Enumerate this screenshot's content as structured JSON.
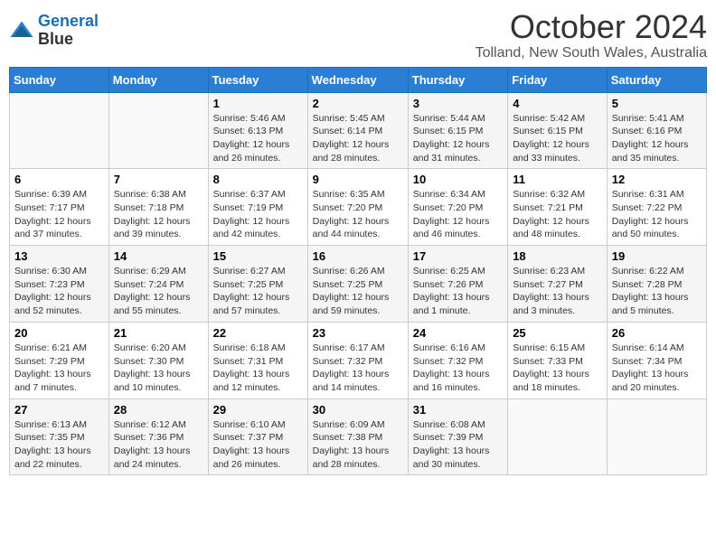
{
  "header": {
    "logo_line1": "General",
    "logo_line2": "Blue",
    "title": "October 2024",
    "subtitle": "Tolland, New South Wales, Australia"
  },
  "days_of_week": [
    "Sunday",
    "Monday",
    "Tuesday",
    "Wednesday",
    "Thursday",
    "Friday",
    "Saturday"
  ],
  "weeks": [
    [
      {
        "num": "",
        "info": ""
      },
      {
        "num": "",
        "info": ""
      },
      {
        "num": "1",
        "info": "Sunrise: 5:46 AM\nSunset: 6:13 PM\nDaylight: 12 hours\nand 26 minutes."
      },
      {
        "num": "2",
        "info": "Sunrise: 5:45 AM\nSunset: 6:14 PM\nDaylight: 12 hours\nand 28 minutes."
      },
      {
        "num": "3",
        "info": "Sunrise: 5:44 AM\nSunset: 6:15 PM\nDaylight: 12 hours\nand 31 minutes."
      },
      {
        "num": "4",
        "info": "Sunrise: 5:42 AM\nSunset: 6:15 PM\nDaylight: 12 hours\nand 33 minutes."
      },
      {
        "num": "5",
        "info": "Sunrise: 5:41 AM\nSunset: 6:16 PM\nDaylight: 12 hours\nand 35 minutes."
      }
    ],
    [
      {
        "num": "6",
        "info": "Sunrise: 6:39 AM\nSunset: 7:17 PM\nDaylight: 12 hours\nand 37 minutes."
      },
      {
        "num": "7",
        "info": "Sunrise: 6:38 AM\nSunset: 7:18 PM\nDaylight: 12 hours\nand 39 minutes."
      },
      {
        "num": "8",
        "info": "Sunrise: 6:37 AM\nSunset: 7:19 PM\nDaylight: 12 hours\nand 42 minutes."
      },
      {
        "num": "9",
        "info": "Sunrise: 6:35 AM\nSunset: 7:20 PM\nDaylight: 12 hours\nand 44 minutes."
      },
      {
        "num": "10",
        "info": "Sunrise: 6:34 AM\nSunset: 7:20 PM\nDaylight: 12 hours\nand 46 minutes."
      },
      {
        "num": "11",
        "info": "Sunrise: 6:32 AM\nSunset: 7:21 PM\nDaylight: 12 hours\nand 48 minutes."
      },
      {
        "num": "12",
        "info": "Sunrise: 6:31 AM\nSunset: 7:22 PM\nDaylight: 12 hours\nand 50 minutes."
      }
    ],
    [
      {
        "num": "13",
        "info": "Sunrise: 6:30 AM\nSunset: 7:23 PM\nDaylight: 12 hours\nand 52 minutes."
      },
      {
        "num": "14",
        "info": "Sunrise: 6:29 AM\nSunset: 7:24 PM\nDaylight: 12 hours\nand 55 minutes."
      },
      {
        "num": "15",
        "info": "Sunrise: 6:27 AM\nSunset: 7:25 PM\nDaylight: 12 hours\nand 57 minutes."
      },
      {
        "num": "16",
        "info": "Sunrise: 6:26 AM\nSunset: 7:25 PM\nDaylight: 12 hours\nand 59 minutes."
      },
      {
        "num": "17",
        "info": "Sunrise: 6:25 AM\nSunset: 7:26 PM\nDaylight: 13 hours\nand 1 minute."
      },
      {
        "num": "18",
        "info": "Sunrise: 6:23 AM\nSunset: 7:27 PM\nDaylight: 13 hours\nand 3 minutes."
      },
      {
        "num": "19",
        "info": "Sunrise: 6:22 AM\nSunset: 7:28 PM\nDaylight: 13 hours\nand 5 minutes."
      }
    ],
    [
      {
        "num": "20",
        "info": "Sunrise: 6:21 AM\nSunset: 7:29 PM\nDaylight: 13 hours\nand 7 minutes."
      },
      {
        "num": "21",
        "info": "Sunrise: 6:20 AM\nSunset: 7:30 PM\nDaylight: 13 hours\nand 10 minutes."
      },
      {
        "num": "22",
        "info": "Sunrise: 6:18 AM\nSunset: 7:31 PM\nDaylight: 13 hours\nand 12 minutes."
      },
      {
        "num": "23",
        "info": "Sunrise: 6:17 AM\nSunset: 7:32 PM\nDaylight: 13 hours\nand 14 minutes."
      },
      {
        "num": "24",
        "info": "Sunrise: 6:16 AM\nSunset: 7:32 PM\nDaylight: 13 hours\nand 16 minutes."
      },
      {
        "num": "25",
        "info": "Sunrise: 6:15 AM\nSunset: 7:33 PM\nDaylight: 13 hours\nand 18 minutes."
      },
      {
        "num": "26",
        "info": "Sunrise: 6:14 AM\nSunset: 7:34 PM\nDaylight: 13 hours\nand 20 minutes."
      }
    ],
    [
      {
        "num": "27",
        "info": "Sunrise: 6:13 AM\nSunset: 7:35 PM\nDaylight: 13 hours\nand 22 minutes."
      },
      {
        "num": "28",
        "info": "Sunrise: 6:12 AM\nSunset: 7:36 PM\nDaylight: 13 hours\nand 24 minutes."
      },
      {
        "num": "29",
        "info": "Sunrise: 6:10 AM\nSunset: 7:37 PM\nDaylight: 13 hours\nand 26 minutes."
      },
      {
        "num": "30",
        "info": "Sunrise: 6:09 AM\nSunset: 7:38 PM\nDaylight: 13 hours\nand 28 minutes."
      },
      {
        "num": "31",
        "info": "Sunrise: 6:08 AM\nSunset: 7:39 PM\nDaylight: 13 hours\nand 30 minutes."
      },
      {
        "num": "",
        "info": ""
      },
      {
        "num": "",
        "info": ""
      }
    ]
  ]
}
